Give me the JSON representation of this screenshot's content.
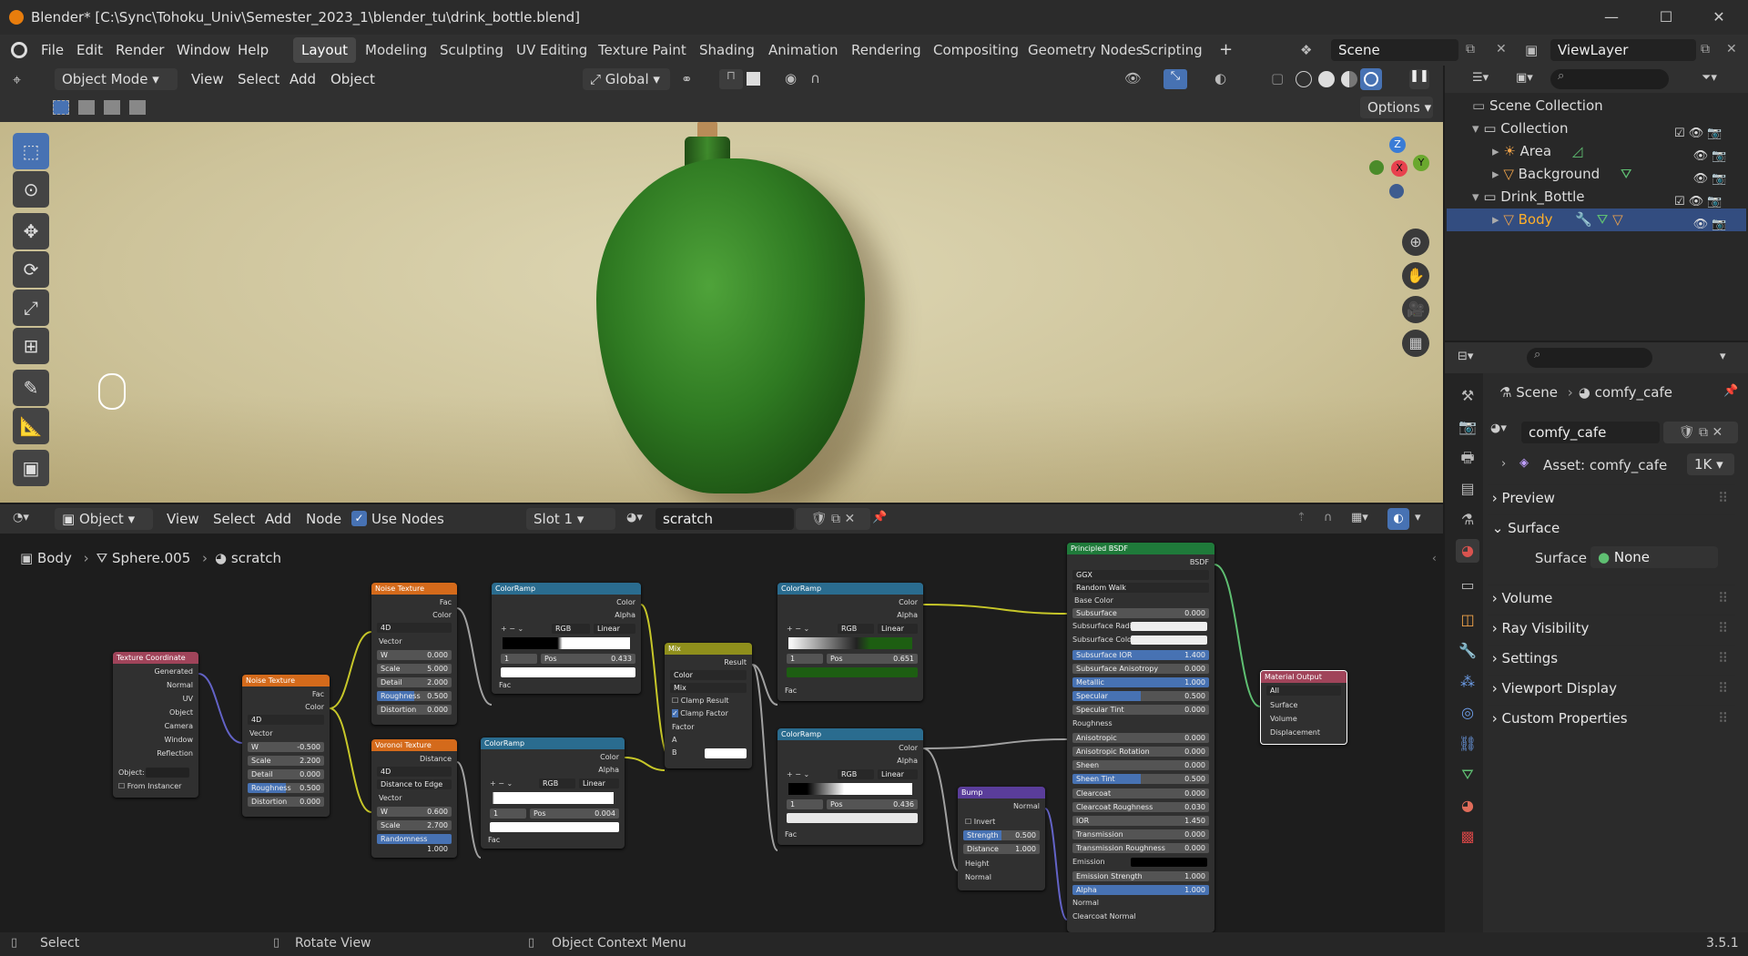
{
  "window": {
    "title": "Blender* [C:\\Sync\\Tohoku_Univ\\Semester_2023_1\\blender_tu\\drink_bottle.blend]",
    "min": "—",
    "max": "☐",
    "close": "✕"
  },
  "menu": {
    "items": [
      "File",
      "Edit",
      "Render",
      "Window",
      "Help"
    ],
    "workspaces": [
      "Layout",
      "Modeling",
      "Sculpting",
      "UV Editing",
      "Texture Paint",
      "Shading",
      "Animation",
      "Rendering",
      "Compositing",
      "Geometry Nodes",
      "Scripting"
    ],
    "add_ws": "+",
    "scene": "Scene",
    "view_layer": "ViewLayer"
  },
  "viewport": {
    "mode": "Object Mode",
    "menus": [
      "View",
      "Select",
      "Add",
      "Object"
    ],
    "orientation": "Global",
    "options": "Options",
    "axes": {
      "z": "Z",
      "y": "Y",
      "x": "X"
    }
  },
  "outliner": {
    "root": "Scene Collection",
    "items": [
      {
        "label": "Collection"
      },
      {
        "label": "Area"
      },
      {
        "label": "Background"
      },
      {
        "label": "Drink_Bottle"
      },
      {
        "label": "Body"
      }
    ]
  },
  "properties": {
    "breadcrumb": [
      "Scene",
      "comfy_cafe"
    ],
    "world": "comfy_cafe",
    "asset": "Asset: comfy_cafe",
    "asset_res": "1K",
    "panels": [
      "Preview",
      "Surface",
      "Volume",
      "Ray Visibility",
      "Settings",
      "Viewport Display",
      "Custom Properties"
    ],
    "surface_label": "Surface",
    "surface_value": "None"
  },
  "node_editor": {
    "editor_type": "Object",
    "menus": [
      "View",
      "Select",
      "Add",
      "Node"
    ],
    "use_nodes": "Use Nodes",
    "slot": "Slot 1",
    "material": "scratch",
    "breadcrumb": [
      "Body",
      "Sphere.005",
      "scratch"
    ]
  },
  "nodes": {
    "texcoord": {
      "title": "Texture Coordinate",
      "outputs": [
        "Generated",
        "Normal",
        "UV",
        "Object",
        "Camera",
        "Window",
        "Reflection"
      ],
      "object": "Object:",
      "from_instancer": "From Instancer"
    },
    "noise1": {
      "title": "Noise Texture",
      "out_fac": "Fac",
      "out_color": "Color",
      "dim": "4D",
      "vector": "Vector",
      "fields": [
        [
          "W",
          "-0.500"
        ],
        [
          "Scale",
          "2.200"
        ],
        [
          "Detail",
          "0.000"
        ],
        [
          "Roughness",
          "0.500"
        ],
        [
          "Distortion",
          "0.000"
        ]
      ]
    },
    "noise2": {
      "title": "Noise Texture",
      "out_fac": "Fac",
      "out_color": "Color",
      "dim": "4D",
      "vector": "Vector",
      "fields": [
        [
          "W",
          "0.000"
        ],
        [
          "Scale",
          "5.000"
        ],
        [
          "Detail",
          "2.000"
        ],
        [
          "Roughness",
          "0.500"
        ],
        [
          "Distortion",
          "0.000"
        ]
      ]
    },
    "voronoi": {
      "title": "Voronoi Texture",
      "out": "Distance",
      "dim": "4D",
      "feature": "Distance to Edge",
      "vector": "Vector",
      "fields": [
        [
          "W",
          "0.600"
        ],
        [
          "Scale",
          "2.700"
        ],
        [
          "Randomness",
          "1.000"
        ]
      ]
    },
    "ramp1": {
      "title": "ColorRamp",
      "color": "Color",
      "alpha": "Alpha",
      "mode": "RGB",
      "interp": "Linear",
      "idx": "1",
      "pos": "Pos",
      "posval": "0.433",
      "fac": "Fac"
    },
    "ramp2": {
      "title": "ColorRamp",
      "color": "Color",
      "alpha": "Alpha",
      "mode": "RGB",
      "interp": "Linear",
      "idx": "1",
      "pos": "Pos",
      "posval": "0.004",
      "fac": "Fac"
    },
    "ramp3": {
      "title": "ColorRamp",
      "color": "Color",
      "alpha": "Alpha",
      "mode": "RGB",
      "interp": "Linear",
      "idx": "1",
      "pos": "Pos",
      "posval": "0.651",
      "fac": "Fac"
    },
    "ramp4": {
      "title": "ColorRamp",
      "color": "Color",
      "alpha": "Alpha",
      "mode": "RGB",
      "interp": "Linear",
      "idx": "1",
      "pos": "Pos",
      "posval": "0.436",
      "fac": "Fac"
    },
    "mix": {
      "title": "Mix",
      "result": "Result",
      "type": "Color",
      "blend": "Mix",
      "clamp_result": "Clamp Result",
      "clamp_factor": "Clamp Factor",
      "factor": "Factor",
      "a": "A",
      "b": "B"
    },
    "bump": {
      "title": "Bump",
      "normal_out": "Normal",
      "invert": "Invert",
      "fields": [
        [
          "Strength",
          "0.500"
        ],
        [
          "Distance",
          "1.000"
        ]
      ],
      "height": "Height",
      "normal_in": "Normal"
    },
    "bsdf": {
      "title": "Principled BSDF",
      "out": "BSDF",
      "dist": "GGX",
      "sss": "Random Walk",
      "base_color": "Base Color",
      "rows": [
        [
          "Subsurface",
          "0.000"
        ],
        [
          "Subsurface Radius",
          ""
        ],
        [
          "Subsurface Color",
          ""
        ],
        [
          "Subsurface IOR",
          "1.400"
        ],
        [
          "Subsurface Anisotropy",
          "0.000"
        ],
        [
          "Metallic",
          "1.000"
        ],
        [
          "Specular",
          "0.500"
        ],
        [
          "Specular Tint",
          "0.000"
        ],
        [
          "Roughness",
          ""
        ],
        [
          "Anisotropic",
          "0.000"
        ],
        [
          "Anisotropic Rotation",
          "0.000"
        ],
        [
          "Sheen",
          "0.000"
        ],
        [
          "Sheen Tint",
          "0.500"
        ],
        [
          "Clearcoat",
          "0.000"
        ],
        [
          "Clearcoat Roughness",
          "0.030"
        ],
        [
          "IOR",
          "1.450"
        ],
        [
          "Transmission",
          "0.000"
        ],
        [
          "Transmission Roughness",
          "0.000"
        ],
        [
          "Emission",
          ""
        ],
        [
          "Emission Strength",
          "1.000"
        ],
        [
          "Alpha",
          "1.000"
        ],
        [
          "Normal",
          ""
        ],
        [
          "Clearcoat Normal",
          ""
        ]
      ]
    },
    "output": {
      "title": "Material Output",
      "target": "All",
      "inputs": [
        "Surface",
        "Volume",
        "Displacement"
      ]
    }
  },
  "status": {
    "select": "Select",
    "rotate": "Rotate View",
    "context": "Object Context Menu",
    "version": "3.5.1"
  }
}
